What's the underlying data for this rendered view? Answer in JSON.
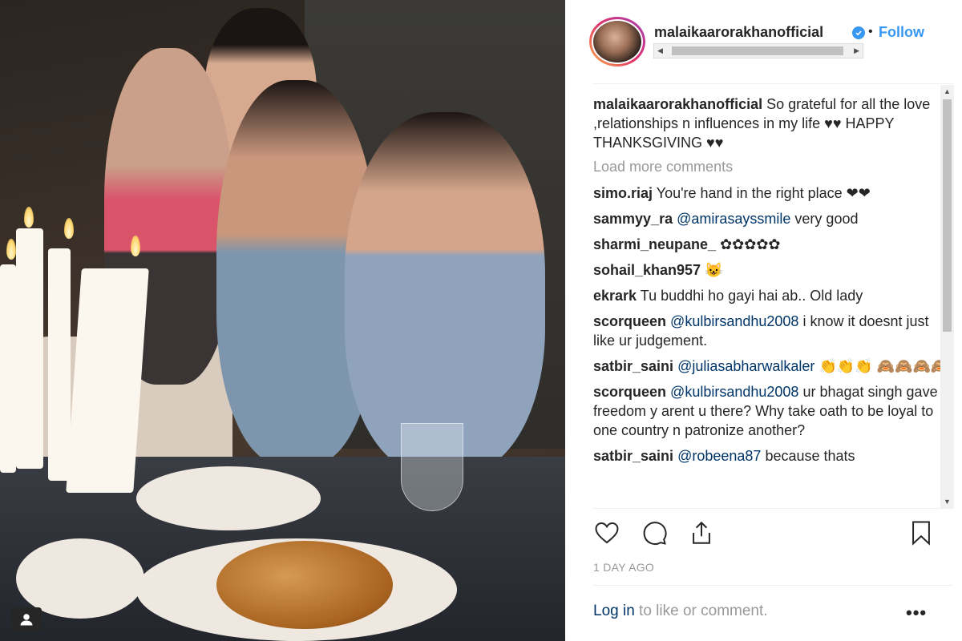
{
  "post": {
    "username": "malaikaarorakhanofficial",
    "follow_label": "Follow",
    "separator": "•",
    "caption_author": "malaikaarorakhanofficial",
    "caption_text": "So grateful for all the love ,relationships n influences in my life ♥♥ HAPPY THANKSGIVING ♥♥",
    "load_more_label": "Load more comments",
    "time_label": "1 DAY AGO",
    "login_link": "Log in",
    "login_suffix": " to like or comment.",
    "more_label": "•••",
    "brand_color": "#3897f0",
    "link_color": "#003569"
  },
  "comments": [
    {
      "author": "simo.riaj",
      "mention": "",
      "text": "You're hand in the right place ❤❤"
    },
    {
      "author": "sammyy_ra",
      "mention": "@amirasayssmile",
      "text": " very good"
    },
    {
      "author": "sharmi_neupane_",
      "mention": "",
      "text": "✿✿✿✿✿"
    },
    {
      "author": "sohail_khan957",
      "mention": "",
      "text": "😺"
    },
    {
      "author": "ekrark",
      "mention": "",
      "text": "Tu buddhi ho gayi hai ab.. Old lady"
    },
    {
      "author": "scorqueen",
      "mention": "@kulbirsandhu2008",
      "text": " i know it doesnt just like ur judgement."
    },
    {
      "author": "satbir_saini",
      "mention": "@juliasabharwalkaler",
      "text": " 👏👏👏 🙈🙈🙈🙈"
    },
    {
      "author": "scorqueen",
      "mention": "@kulbirsandhu2008",
      "text": " ur bhagat singh gave u freedom y arent u there? Why take oath to be loyal to one country n patronize another?"
    },
    {
      "author": "satbir_saini",
      "mention": "@robeena87",
      "text": " because thats"
    }
  ],
  "icons": {
    "verified": "verified-badge-icon",
    "like": "heart-icon",
    "comment": "comment-bubble-icon",
    "share": "share-icon",
    "save": "bookmark-icon",
    "photo_user": "user-tag-icon"
  }
}
